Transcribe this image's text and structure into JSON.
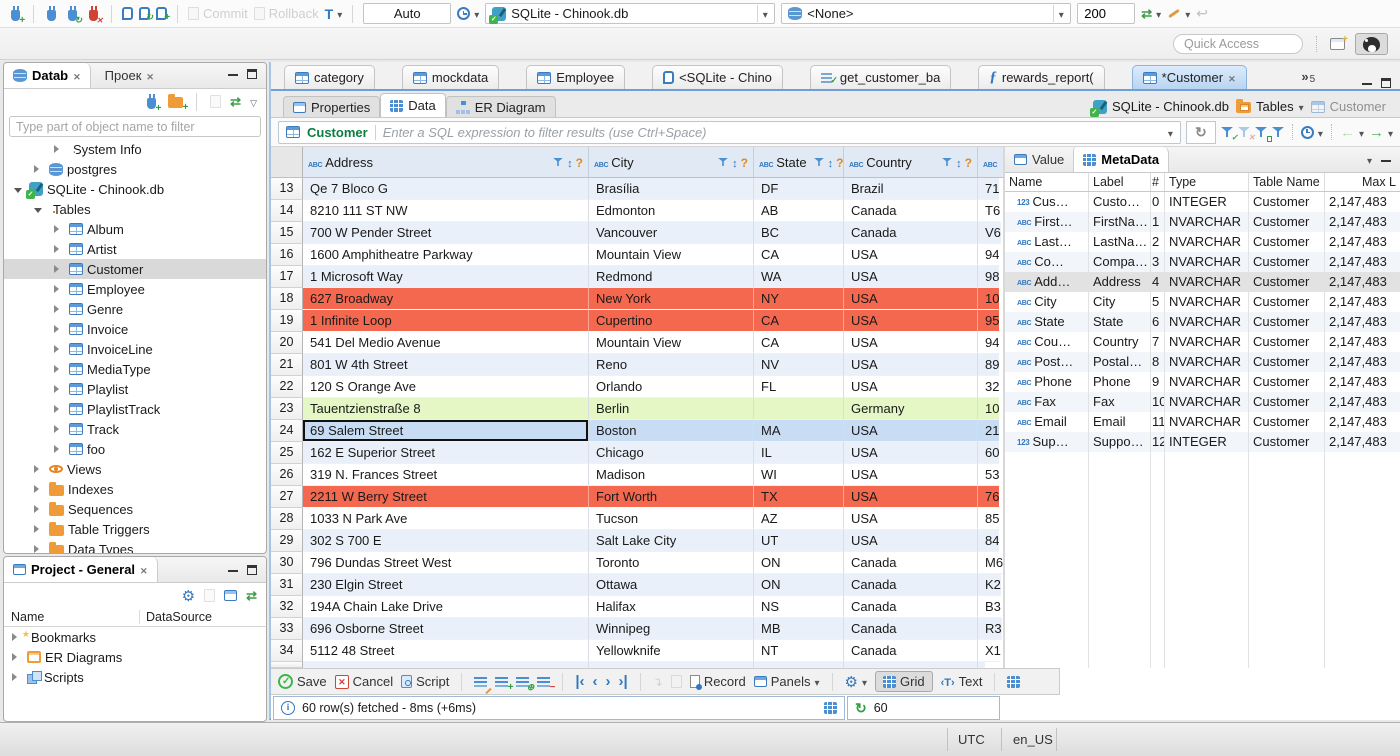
{
  "topbar": {
    "commit": "Commit",
    "rollback": "Rollback",
    "txn_mode": "Auto",
    "connection": "SQLite - Chinook.db",
    "schema": "<None>",
    "fetch_size": "200",
    "quick_access": "Quick Access"
  },
  "sidebar": {
    "tabs": [
      {
        "label": "Datab",
        "icon": "db",
        "state": "on"
      },
      {
        "label": "Проек",
        "icon": "folder-proj",
        "state": "off"
      }
    ],
    "filter_placeholder": "Type part of object name to filter",
    "tree": [
      {
        "lvl": "2",
        "arrow": "r",
        "icon": "folder-info",
        "label": "System Info"
      },
      {
        "lvl": "1",
        "arrow": "r",
        "icon": "db",
        "label": "postgres"
      },
      {
        "lvl": "0",
        "arrow": "d",
        "icon": "db-sqlite",
        "label": "SQLite - Chinook.db"
      },
      {
        "lvl": "1",
        "arrow": "d",
        "icon": "folder-table",
        "label": "Tables"
      },
      {
        "lvl": "2",
        "arrow": "r",
        "icon": "table",
        "label": "Album"
      },
      {
        "lvl": "2",
        "arrow": "r",
        "icon": "table",
        "label": "Artist"
      },
      {
        "lvl": "2",
        "arrow": "r",
        "icon": "table",
        "label": "Customer",
        "hl": "sel"
      },
      {
        "lvl": "2",
        "arrow": "r",
        "icon": "table",
        "label": "Employee"
      },
      {
        "lvl": "2",
        "arrow": "r",
        "icon": "table",
        "label": "Genre"
      },
      {
        "lvl": "2",
        "arrow": "r",
        "icon": "table",
        "label": "Invoice"
      },
      {
        "lvl": "2",
        "arrow": "r",
        "icon": "table",
        "label": "InvoiceLine"
      },
      {
        "lvl": "2",
        "arrow": "r",
        "icon": "table",
        "label": "MediaType"
      },
      {
        "lvl": "2",
        "arrow": "r",
        "icon": "table",
        "label": "Playlist"
      },
      {
        "lvl": "2",
        "arrow": "r",
        "icon": "table",
        "label": "PlaylistTrack"
      },
      {
        "lvl": "2",
        "arrow": "r",
        "icon": "table",
        "label": "Track"
      },
      {
        "lvl": "2",
        "arrow": "r",
        "icon": "table",
        "label": "foo"
      },
      {
        "lvl": "1",
        "arrow": "r",
        "icon": "eye",
        "label": "Views"
      },
      {
        "lvl": "1",
        "arrow": "r",
        "icon": "folder",
        "label": "Indexes"
      },
      {
        "lvl": "1",
        "arrow": "r",
        "icon": "folder",
        "label": "Sequences"
      },
      {
        "lvl": "1",
        "arrow": "r",
        "icon": "folder",
        "label": "Table Triggers"
      },
      {
        "lvl": "1",
        "arrow": "r",
        "icon": "folder",
        "label": "Data Types"
      }
    ]
  },
  "project": {
    "title": "Project - General",
    "columns": {
      "name": "Name",
      "source": "DataSource"
    },
    "items": [
      {
        "arrow": "r",
        "icon": "folder-star",
        "label": "Bookmarks"
      },
      {
        "arrow": "r",
        "icon": "erdbox",
        "label": "ER Diagrams"
      },
      {
        "arrow": "r",
        "icon": "scripts",
        "label": "Scripts"
      }
    ]
  },
  "editor": {
    "tabs": [
      {
        "icon": "table",
        "label": "category",
        "state": "off"
      },
      {
        "icon": "table",
        "label": "mockdata",
        "state": "off"
      },
      {
        "icon": "table",
        "label": "Employee",
        "state": "off"
      },
      {
        "icon": "sql",
        "label": "<SQLite - Chino",
        "state": "off"
      },
      {
        "icon": "script",
        "label": "get_customer_ba",
        "state": "off"
      },
      {
        "icon": "func",
        "label": "rewards_report(",
        "state": "off"
      },
      {
        "icon": "table",
        "label": "*Customer",
        "state": "on"
      }
    ],
    "overflow_count": "5",
    "subtabs": [
      {
        "icon": "props",
        "label": "Properties",
        "state": "off"
      },
      {
        "icon": "grid",
        "label": "Data",
        "state": "on"
      },
      {
        "icon": "erd",
        "label": "ER Diagram",
        "state": "off"
      }
    ],
    "breadcrumb": {
      "connection": "SQLite - Chinook.db",
      "container": "Tables",
      "entity": "Customer"
    },
    "filter": {
      "entity": "Customer",
      "placeholder": "Enter a SQL expression to filter results (use Ctrl+Space)"
    }
  },
  "grid": {
    "columns": [
      {
        "label": "Address",
        "cls": "gaddr"
      },
      {
        "label": "City",
        "cls": "gcity"
      },
      {
        "label": "State",
        "cls": "gstate"
      },
      {
        "label": "Country",
        "cls": "gcountry"
      }
    ],
    "rows": [
      {
        "num": "13",
        "address": "Qe 7 Bloco G",
        "city": "Brasília",
        "state": "DF",
        "country": "Brazil",
        "extra": "71",
        "hl": "alt"
      },
      {
        "num": "14",
        "address": "8210 111 ST NW",
        "city": "Edmonton",
        "state": "AB",
        "country": "Canada",
        "extra": "T6"
      },
      {
        "num": "15",
        "address": "700 W Pender Street",
        "city": "Vancouver",
        "state": "BC",
        "country": "Canada",
        "extra": "V6",
        "hl": "alt"
      },
      {
        "num": "16",
        "address": "1600 Amphitheatre Parkway",
        "city": "Mountain View",
        "state": "CA",
        "country": "USA",
        "extra": "94"
      },
      {
        "num": "17",
        "address": "1 Microsoft Way",
        "city": "Redmond",
        "state": "WA",
        "country": "USA",
        "extra": "98",
        "hl": "alt"
      },
      {
        "num": "18",
        "address": "627 Broadway",
        "city": "New York",
        "state": "NY",
        "country": "USA",
        "extra": "10",
        "hl": "red"
      },
      {
        "num": "19",
        "address": "1 Infinite Loop",
        "city": "Cupertino",
        "state": "CA",
        "country": "USA",
        "extra": "95",
        "hl": "red"
      },
      {
        "num": "20",
        "address": "541 Del Medio Avenue",
        "city": "Mountain View",
        "state": "CA",
        "country": "USA",
        "extra": "94"
      },
      {
        "num": "21",
        "address": "801 W 4th Street",
        "city": "Reno",
        "state": "NV",
        "country": "USA",
        "extra": "89",
        "hl": "alt"
      },
      {
        "num": "22",
        "address": "120 S Orange Ave",
        "city": "Orlando",
        "state": "FL",
        "country": "USA",
        "extra": "32"
      },
      {
        "num": "23",
        "address": "Tauentzienstraße 8",
        "city": "Berlin",
        "state": "",
        "country": "Germany",
        "extra": "10",
        "hl": "green"
      },
      {
        "num": "24",
        "address": "69 Salem Street",
        "city": "Boston",
        "state": "MA",
        "country": "USA",
        "extra": "21",
        "hl": "sel"
      },
      {
        "num": "25",
        "address": "162 E Superior Street",
        "city": "Chicago",
        "state": "IL",
        "country": "USA",
        "extra": "60",
        "hl": "alt"
      },
      {
        "num": "26",
        "address": "319 N. Frances Street",
        "city": "Madison",
        "state": "WI",
        "country": "USA",
        "extra": "53"
      },
      {
        "num": "27",
        "address": "2211 W Berry Street",
        "city": "Fort Worth",
        "state": "TX",
        "country": "USA",
        "extra": "76",
        "hl": "red"
      },
      {
        "num": "28",
        "address": "1033 N Park Ave",
        "city": "Tucson",
        "state": "AZ",
        "country": "USA",
        "extra": "85"
      },
      {
        "num": "29",
        "address": "302 S 700 E",
        "city": "Salt Lake City",
        "state": "UT",
        "country": "USA",
        "extra": "84",
        "hl": "alt"
      },
      {
        "num": "30",
        "address": "796 Dundas Street West",
        "city": "Toronto",
        "state": "ON",
        "country": "Canada",
        "extra": "M6"
      },
      {
        "num": "31",
        "address": "230 Elgin Street",
        "city": "Ottawa",
        "state": "ON",
        "country": "Canada",
        "extra": "K2",
        "hl": "alt"
      },
      {
        "num": "32",
        "address": "194A Chain Lake Drive",
        "city": "Halifax",
        "state": "NS",
        "country": "Canada",
        "extra": "B3"
      },
      {
        "num": "33",
        "address": "696 Osborne Street",
        "city": "Winnipeg",
        "state": "MB",
        "country": "Canada",
        "extra": "R3",
        "hl": "alt"
      },
      {
        "num": "34",
        "address": "5112 48 Street",
        "city": "Yellowknife",
        "state": "NT",
        "country": "Canada",
        "extra": "X1"
      }
    ]
  },
  "meta": {
    "tabs": [
      {
        "label": "Value",
        "icon": "window",
        "state": "off"
      },
      {
        "label": "MetaData",
        "icon": "grid",
        "state": "on"
      }
    ],
    "columns": [
      {
        "label": "Name",
        "cls": "m1"
      },
      {
        "label": "Label",
        "cls": "m2"
      },
      {
        "label": "#",
        "cls": "m3"
      },
      {
        "label": "Type",
        "cls": "m4"
      },
      {
        "label": "Table Name",
        "cls": "m5"
      },
      {
        "label": "Max L",
        "cls": "m6"
      }
    ],
    "rows": [
      {
        "kind": "123",
        "name": "Cus…",
        "label": "Custo…",
        "num": "0",
        "type": "INTEGER",
        "table": "Customer",
        "max": "2,147,483"
      },
      {
        "kind": "abc",
        "name": "First…",
        "label": "FirstNa…",
        "num": "1",
        "type": "NVARCHAR",
        "table": "Customer",
        "max": "2,147,483",
        "hl": "alt"
      },
      {
        "kind": "abc",
        "name": "Last…",
        "label": "LastNa…",
        "num": "2",
        "type": "NVARCHAR",
        "table": "Customer",
        "max": "2,147,483"
      },
      {
        "kind": "abc",
        "name": "Co…",
        "label": "Compa…",
        "num": "3",
        "type": "NVARCHAR",
        "table": "Customer",
        "max": "2,147,483",
        "hl": "alt"
      },
      {
        "kind": "abc",
        "name": "Add…",
        "label": "Address",
        "num": "4",
        "type": "NVARCHAR",
        "table": "Customer",
        "max": "2,147,483",
        "hl": "sel"
      },
      {
        "kind": "abc",
        "name": "City",
        "label": "City",
        "num": "5",
        "type": "NVARCHAR",
        "table": "Customer",
        "max": "2,147,483"
      },
      {
        "kind": "abc",
        "name": "State",
        "label": "State",
        "num": "6",
        "type": "NVARCHAR",
        "table": "Customer",
        "max": "2,147,483",
        "hl": "alt"
      },
      {
        "kind": "abc",
        "name": "Cou…",
        "label": "Country",
        "num": "7",
        "type": "NVARCHAR",
        "table": "Customer",
        "max": "2,147,483"
      },
      {
        "kind": "abc",
        "name": "Post…",
        "label": "Postal…",
        "num": "8",
        "type": "NVARCHAR",
        "table": "Customer",
        "max": "2,147,483",
        "hl": "alt"
      },
      {
        "kind": "abc",
        "name": "Phone",
        "label": "Phone",
        "num": "9",
        "type": "NVARCHAR",
        "table": "Customer",
        "max": "2,147,483"
      },
      {
        "kind": "abc",
        "name": "Fax",
        "label": "Fax",
        "num": "10",
        "type": "NVARCHAR",
        "table": "Customer",
        "max": "2,147,483",
        "hl": "alt"
      },
      {
        "kind": "abc",
        "name": "Email",
        "label": "Email",
        "num": "11",
        "type": "NVARCHAR",
        "table": "Customer",
        "max": "2,147,483"
      },
      {
        "kind": "123",
        "name": "Sup…",
        "label": "Suppo…",
        "num": "12",
        "type": "INTEGER",
        "table": "Customer",
        "max": "2,147,483",
        "hl": "alt"
      }
    ]
  },
  "bottombar": {
    "save": "Save",
    "cancel": "Cancel",
    "script": "Script",
    "record": "Record",
    "panels": "Panels",
    "grid": "Grid",
    "text": "Text"
  },
  "status": {
    "message": "60 row(s) fetched - 8ms (+6ms)",
    "refresh_count": "60"
  },
  "footer": {
    "timezone": "UTC",
    "locale": "en_US"
  }
}
